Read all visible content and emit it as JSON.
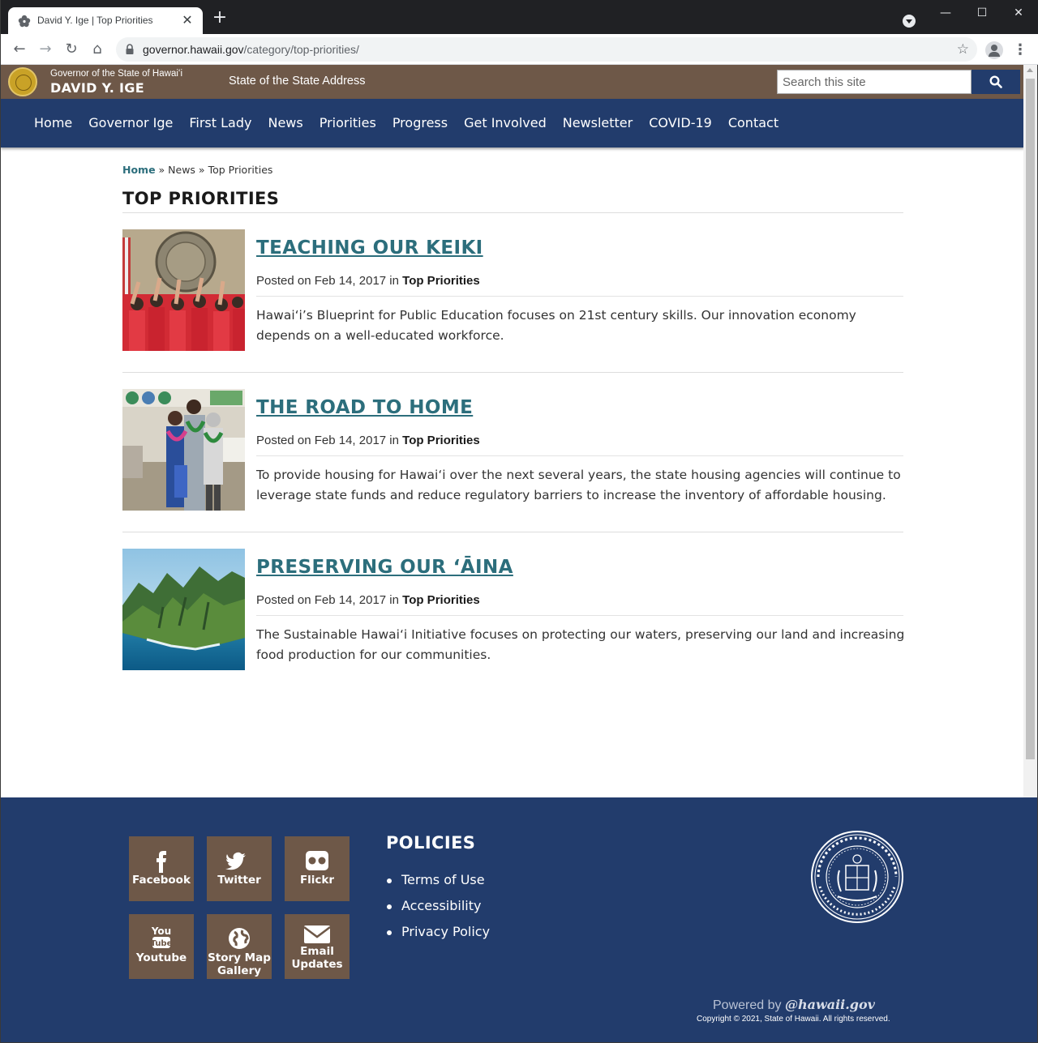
{
  "browser": {
    "tab_title": "David Y. Ige | Top Priorities",
    "url_host": "governor.hawaii.gov",
    "url_path": "/category/top-priorities/"
  },
  "header": {
    "governor_line": "Governor of the State of Hawaiʻi",
    "governor_name": "DAVID Y. IGE",
    "state_address_link": "State of the State Address",
    "search_placeholder": "Search this site"
  },
  "nav": {
    "items": [
      "Home",
      "Governor Ige",
      "First Lady",
      "News",
      "Priorities",
      "Progress",
      "Get Involved",
      "Newsletter",
      "COVID-19",
      "Contact"
    ]
  },
  "breadcrumb": {
    "home": "Home",
    "sep1": " » ",
    "news": "News",
    "sep2": " » ",
    "current": "Top Priorities"
  },
  "page": {
    "title": "TOP PRIORITIES"
  },
  "posts": [
    {
      "title": "TEACHING OUR KEIKI",
      "posted_prefix": "Posted on Feb 14, 2017 in ",
      "category": "Top Priorities",
      "excerpt": "Hawai‘i’s Blueprint for Public Education focuses on 21st century skills. Our innovation economy depends on a well-educated workforce."
    },
    {
      "title": "THE ROAD TO HOME",
      "posted_prefix": "Posted on Feb 14, 2017 in ",
      "category": "Top Priorities",
      "excerpt": "To provide housing for Hawai‘i over the next several years, the state housing agencies will continue to leverage state funds and reduce regulatory barriers to increase the inventory of affordable housing."
    },
    {
      "title": "PRESERVING OUR ‘ĀINA",
      "posted_prefix": "Posted on Feb 14, 2017 in ",
      "category": "Top Priorities",
      "excerpt": "The Sustainable Hawai‘i Initiative focuses on protecting our waters, preserving our land and increasing food production for our communities."
    }
  ],
  "footer": {
    "social": {
      "facebook": "Facebook",
      "twitter": "Twitter",
      "flickr": "Flickr",
      "youtube": "Youtube",
      "story_map_line1": "Story Map",
      "story_map_line2": "Gallery",
      "email_line1": "Email",
      "email_line2": "Updates"
    },
    "policies_title": "POLICIES",
    "policies": [
      "Terms of Use",
      "Accessibility",
      "Privacy Policy"
    ],
    "powered_prefix": "Powered by ",
    "powered_brand": "@hawaii.gov",
    "copyright": "Copyright © 2021, State of Hawaii. All rights reserved."
  },
  "colors": {
    "header_brown": "#6e5848",
    "nav_blue": "#223c6c",
    "link_teal": "#2c6e7c"
  }
}
